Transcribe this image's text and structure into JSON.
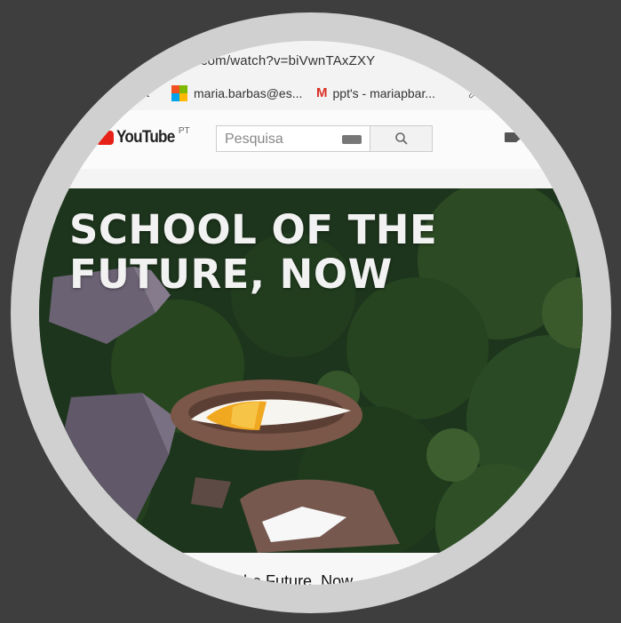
{
  "browser": {
    "url": "e.com/watch?v=biVwnTAxZXY"
  },
  "bookmarks": [
    {
      "label": "a"
    },
    {
      "label": "maria.barbas@es..."
    },
    {
      "label": "ppt's - mariapbar..."
    }
  ],
  "youtube": {
    "logo_text": "YouTube",
    "region": "PT",
    "search_placeholder": "Pesquisa"
  },
  "video": {
    "overlay_title_line1": "SCHOOL OF THE",
    "overlay_title_line2": "FUTURE, NOW",
    "page_title_fragment": "ol of the Future, Now"
  },
  "colors": {
    "background": "#3e3e3e",
    "ring": "#d0d0d0",
    "youtube_red": "#e62117",
    "foliage": "#1f3a1e"
  }
}
